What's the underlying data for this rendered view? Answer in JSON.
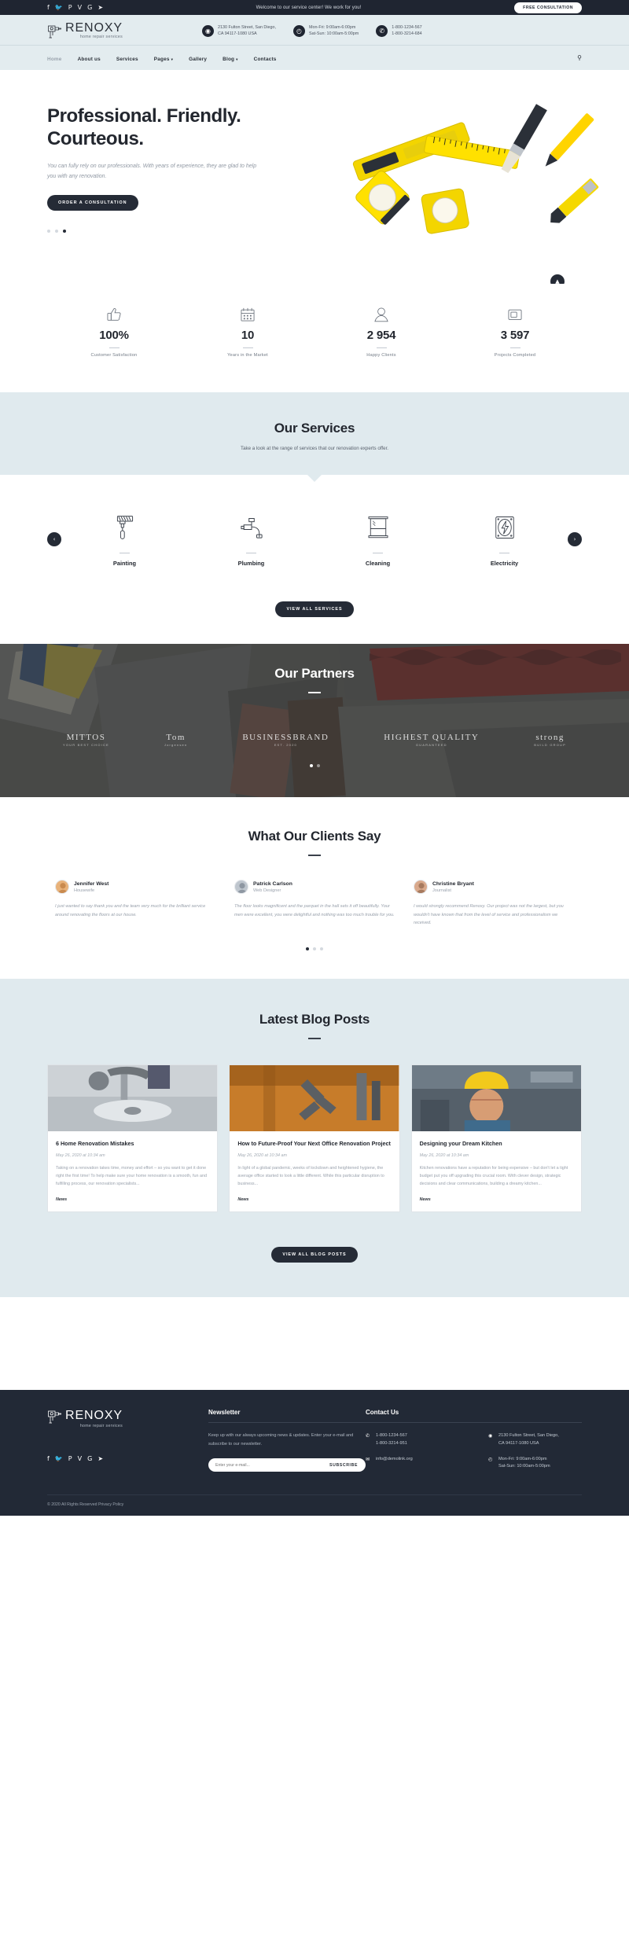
{
  "topbar": {
    "social": [
      {
        "name": "facebook",
        "glyph": "f"
      },
      {
        "name": "twitter",
        "glyph": "🐦"
      },
      {
        "name": "pinterest",
        "glyph": "P"
      },
      {
        "name": "vimeo",
        "glyph": "V"
      },
      {
        "name": "google-plus",
        "glyph": "G"
      },
      {
        "name": "rss",
        "glyph": "➤"
      }
    ],
    "welcome": "Welcome to our service center! We work for you!",
    "cta": "FREE CONSULTATION"
  },
  "brand": {
    "name": "RENOXY",
    "tagline": "home repair services"
  },
  "header_info": [
    {
      "icon": "location-pin-icon",
      "line1": "2130 Fulton Street, San Diego,",
      "line2": "CA 94117-1080 USA"
    },
    {
      "icon": "clock-icon",
      "line1": "Mon-Fri: 9:00am-6:00pm",
      "line2": "Sat-Sun: 10:00am-5:00pm"
    },
    {
      "icon": "phone-icon",
      "line1": "1-800-1234-567",
      "line2": "1-800-3214-684"
    }
  ],
  "nav": {
    "items": [
      {
        "label": "Home",
        "active": true,
        "caret": false
      },
      {
        "label": "About us",
        "active": false,
        "caret": false
      },
      {
        "label": "Services",
        "active": false,
        "caret": false
      },
      {
        "label": "Pages",
        "active": false,
        "caret": true
      },
      {
        "label": "Gallery",
        "active": false,
        "caret": false
      },
      {
        "label": "Blog",
        "active": false,
        "caret": true
      },
      {
        "label": "Contacts",
        "active": false,
        "caret": false
      }
    ],
    "search_icon": "search-icon"
  },
  "hero": {
    "title_line1": "Professional. Friendly.",
    "title_line2": "Courteous.",
    "text": "You can fully rely on our professionals. With years of experience, they are glad to help you with any renovation.",
    "cta": "ORDER A CONSULTATION",
    "slides": 3,
    "active_slide": 3,
    "scroll_top_icon": "chevron-up-icon"
  },
  "stats": [
    {
      "icon": "thumbs-up-icon",
      "value": "100%",
      "label": "Customer Satisfaction"
    },
    {
      "icon": "calendar-icon",
      "value": "10",
      "label": "Years in the Market"
    },
    {
      "icon": "person-icon",
      "value": "2 954",
      "label": "Happy Clients"
    },
    {
      "icon": "window-frame-icon",
      "value": "3 597",
      "label": "Projects Completed"
    }
  ],
  "services": {
    "title": "Our Services",
    "subtitle": "Take a look at the range of services that our renovation experts offer.",
    "prev_icon": "chevron-left-icon",
    "next_icon": "chevron-right-icon",
    "items": [
      {
        "icon": "paint-roller-icon",
        "name": "Painting"
      },
      {
        "icon": "faucet-icon",
        "name": "Plumbing"
      },
      {
        "icon": "window-icon",
        "name": "Cleaning"
      },
      {
        "icon": "lightning-bolt-icon",
        "name": "Electricity"
      }
    ],
    "cta": "VIEW ALL SERVICES"
  },
  "partners": {
    "title": "Our Partners",
    "logos": [
      {
        "line1": "MITTOS",
        "line2": "YOUR BEST CHOICE"
      },
      {
        "line1": "Tom",
        "line2": "Jorgensen"
      },
      {
        "line1": "BUSINESSBRAND",
        "line2": "EST. 2020"
      },
      {
        "line1": "HIGHEST QUALITY",
        "line2": "GUARANTEED"
      },
      {
        "line1": "strong",
        "line2": "BUILD GROUP"
      }
    ],
    "slides": 2,
    "active_slide": 1
  },
  "testimonials": {
    "title": "What Our Clients Say",
    "items": [
      {
        "name": "Jennifer West",
        "role": "Housewife",
        "text": "I just wanted to say thank you and the team very much for the brilliant service around renovating the floors at our house."
      },
      {
        "name": "Patrick Carlson",
        "role": "Web Designer",
        "text": "The floor looks magnificent and the parquet in the hall sets it off beautifully. Your men were excellent, you were delightful and nothing was too much trouble for you."
      },
      {
        "name": "Christine Bryant",
        "role": "Journalist",
        "text": "I would strongly recommend Renoxy. Our project was not the largest, but you wouldn't have known that from the level of service and professionalism we received."
      }
    ],
    "slides": 3,
    "active_slide": 1
  },
  "blog": {
    "title": "Latest Blog Posts",
    "posts": [
      {
        "image": "plumber-fixing-sink-drain",
        "title": "6 Home Renovation Mistakes",
        "date": "May 26, 2020 at 10:34 am",
        "excerpt": "Taking on a renovation takes time, money and effort – so you want to get it done right the first time! To help make sure your home renovation is a smooth, fun and fulfilling process, our renovation specialists...",
        "category": "News"
      },
      {
        "image": "pliers-and-tools-on-orange-wall",
        "title": "How to Future-Proof Your Next Office Renovation Project",
        "date": "May 26, 2020 at 10:34 am",
        "excerpt": "In light of a global pandemic, weeks of lockdown and heightened hygiene, the average office started to look a little different. While this particular disruption to business...",
        "category": "News"
      },
      {
        "image": "worker-in-yellow-hard-hat",
        "title": "Designing your Dream Kitchen",
        "date": "May 26, 2020 at 10:34 am",
        "excerpt": "Kitchen renovations have a reputation for being expensive – but don't let a tight budget put you off upgrading this crucial room. With clever design, strategic decisions and clear communications, building a dreamy kitchen...",
        "category": "News"
      }
    ],
    "cta": "VIEW ALL BLOG POSTS"
  },
  "footer": {
    "newsletter": {
      "heading": "Newsletter",
      "text": "Keep up with our always upcoming news & updates. Enter your e-mail and subscribe to our newsletter.",
      "placeholder": "Enter your e-mail...",
      "button": "SUBSCRIBE"
    },
    "contact": {
      "heading": "Contact Us",
      "left": [
        {
          "icon": "phone-icon",
          "line1": "1-800-1234-567",
          "line2": "1-800-3214-951"
        },
        {
          "icon": "mail-icon",
          "line1": "info@demolink.org",
          "line2": ""
        }
      ],
      "right": [
        {
          "icon": "location-pin-icon",
          "line1": "2130 Fulton Street, San Diego,",
          "line2": "CA 94117-1080 USA"
        },
        {
          "icon": "clock-icon",
          "line1": "Mon-Fri: 9:00am-6:00pm",
          "line2": "Sat-Sun: 10:00am-5:00pm"
        }
      ]
    },
    "copyright": "© 2020 All Rights Reserved",
    "privacy": "Privacy Policy"
  },
  "colors": {
    "dark": "#222936",
    "light_blue": "#e0eaee",
    "accent_yellow": "#f5d800"
  }
}
